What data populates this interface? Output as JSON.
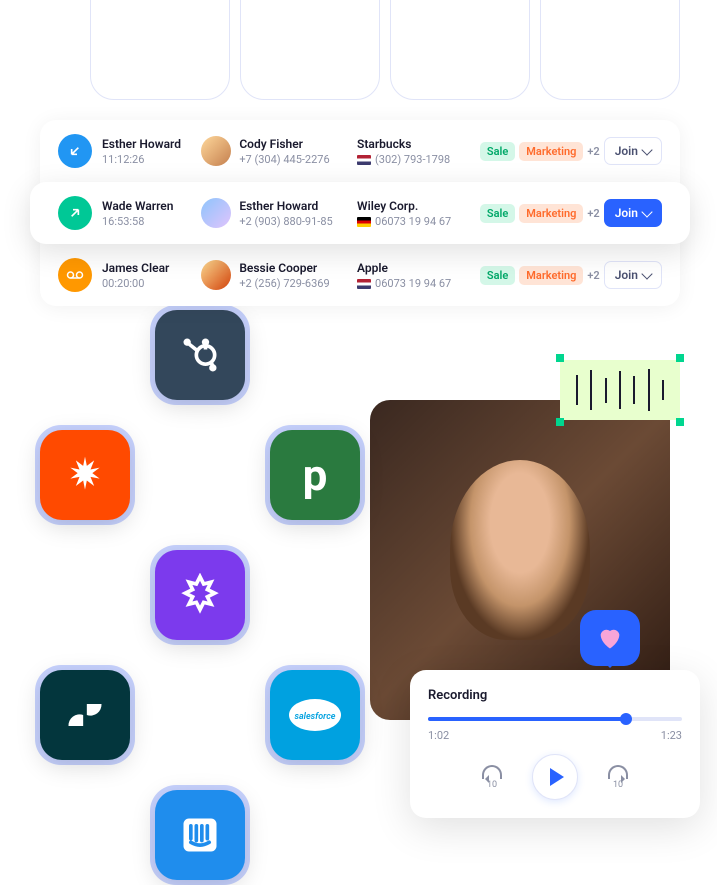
{
  "calls": [
    {
      "dir": "in",
      "caller": "Esther Howard",
      "time": "11:12:26",
      "contact": "Cody Fisher",
      "phone": "+7 (304) 445-2276",
      "company": "Starbucks",
      "company_phone": "(302) 793-1798",
      "flag": "us",
      "tag1": "Sale",
      "tag2": "Marketing",
      "more": "+2",
      "join": "Join",
      "primary": false
    },
    {
      "dir": "out",
      "caller": "Wade Warren",
      "time": "16:53:58",
      "contact": "Esther Howard",
      "phone": "+2 (903) 880-91-85",
      "company": "Wiley Corp.",
      "company_phone": "06073 19 94 67",
      "flag": "de",
      "tag1": "Sale",
      "tag2": "Marketing",
      "more": "+2",
      "join": "Join",
      "primary": true
    },
    {
      "dir": "vm",
      "caller": "James Clear",
      "time": "00:20:00",
      "contact": "Bessie Cooper",
      "phone": "+2 (256) 729-6369",
      "company": "Apple",
      "company_phone": "06073 19 94 67",
      "flag": "us",
      "tag1": "Sale",
      "tag2": "Marketing",
      "more": "+2",
      "join": "Join",
      "primary": false
    }
  ],
  "integrations": [
    "hubspot",
    "zapier",
    "pipedrive",
    "gong",
    "zendesk",
    "salesforce",
    "intercom"
  ],
  "player": {
    "title": "Recording",
    "current": "1:02",
    "total": "1:23",
    "skip": "10"
  }
}
